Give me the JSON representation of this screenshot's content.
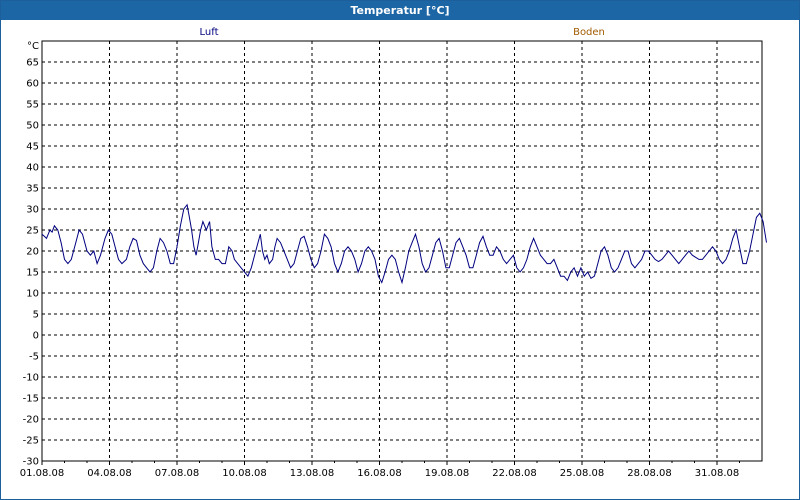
{
  "window": {
    "title": "Temperatur [°C]"
  },
  "colors": {
    "titlebar": "#1d66a5",
    "luft": "#000080",
    "boden": "#a05a00",
    "grid": "#000000"
  },
  "chart_data": {
    "type": "line",
    "title": "Temperatur [°C]",
    "ylabel": "°C",
    "xlabel": "",
    "ylim": [
      -30,
      70
    ],
    "xlim": [
      "01.08.08",
      "02.09.08"
    ],
    "grid": true,
    "legend": [
      "Luft",
      "Boden"
    ],
    "y_ticks": [
      "65",
      "60",
      "55",
      "50",
      "45",
      "40",
      "35",
      "30",
      "25",
      "20",
      "15",
      "10",
      "5",
      "0",
      "-5",
      "-10",
      "-15",
      "-20",
      "-25",
      "-30"
    ],
    "x_ticks": [
      "01.08.08",
      "04.08.08",
      "07.08.08",
      "10.08.08",
      "13.08.08",
      "16.08.08",
      "19.08.08",
      "22.08.08",
      "25.08.08",
      "28.08.08",
      "31.08.08"
    ],
    "series": [
      {
        "name": "Luft",
        "x_unit": "days since 01.08.08",
        "points": [
          [
            0.0,
            24
          ],
          [
            0.1,
            23.5
          ],
          [
            0.2,
            23
          ],
          [
            0.35,
            25
          ],
          [
            0.45,
            24.5
          ],
          [
            0.55,
            26
          ],
          [
            0.7,
            25
          ],
          [
            0.85,
            22
          ],
          [
            1.0,
            18
          ],
          [
            1.15,
            17
          ],
          [
            1.3,
            18
          ],
          [
            1.5,
            22
          ],
          [
            1.65,
            25
          ],
          [
            1.8,
            24
          ],
          [
            2.0,
            20
          ],
          [
            2.15,
            19
          ],
          [
            2.3,
            20
          ],
          [
            2.45,
            17
          ],
          [
            2.6,
            19
          ],
          [
            2.8,
            23
          ],
          [
            2.95,
            25
          ],
          [
            3.1,
            24
          ],
          [
            3.25,
            21
          ],
          [
            3.4,
            18
          ],
          [
            3.55,
            17
          ],
          [
            3.75,
            18
          ],
          [
            3.9,
            21
          ],
          [
            4.05,
            23
          ],
          [
            4.2,
            22.5
          ],
          [
            4.35,
            19
          ],
          [
            4.5,
            17
          ],
          [
            4.65,
            16
          ],
          [
            4.8,
            15
          ],
          [
            4.95,
            16
          ],
          [
            5.1,
            20
          ],
          [
            5.25,
            23
          ],
          [
            5.4,
            22
          ],
          [
            5.55,
            20
          ],
          [
            5.7,
            17
          ],
          [
            5.85,
            17
          ],
          [
            6.0,
            21
          ],
          [
            6.15,
            26
          ],
          [
            6.3,
            30
          ],
          [
            6.45,
            31
          ],
          [
            6.55,
            28
          ],
          [
            6.65,
            25
          ],
          [
            6.75,
            21
          ],
          [
            6.85,
            19
          ],
          [
            6.95,
            22
          ],
          [
            7.05,
            25
          ],
          [
            7.15,
            27
          ],
          [
            7.3,
            25
          ],
          [
            7.45,
            27
          ],
          [
            7.55,
            21
          ],
          [
            7.7,
            18
          ],
          [
            7.85,
            18
          ],
          [
            8.0,
            17
          ],
          [
            8.15,
            17
          ],
          [
            8.3,
            21
          ],
          [
            8.45,
            20
          ],
          [
            8.55,
            18
          ],
          [
            8.7,
            17
          ],
          [
            8.85,
            16
          ],
          [
            9.0,
            15
          ],
          [
            9.15,
            14
          ],
          [
            9.3,
            16
          ],
          [
            9.45,
            19
          ],
          [
            9.6,
            22
          ],
          [
            9.7,
            24
          ],
          [
            9.8,
            20
          ],
          [
            9.9,
            18
          ],
          [
            10.0,
            19
          ],
          [
            10.1,
            17
          ],
          [
            10.25,
            18
          ],
          [
            10.35,
            21
          ],
          [
            10.45,
            23
          ],
          [
            10.6,
            22
          ],
          [
            10.75,
            20
          ],
          [
            10.9,
            18
          ],
          [
            11.05,
            16
          ],
          [
            11.2,
            17
          ],
          [
            11.35,
            20
          ],
          [
            11.5,
            23
          ],
          [
            11.65,
            23.5
          ],
          [
            11.8,
            21
          ],
          [
            11.95,
            18
          ],
          [
            12.1,
            16
          ],
          [
            12.25,
            17
          ],
          [
            12.4,
            20
          ],
          [
            12.55,
            24
          ],
          [
            12.7,
            23
          ],
          [
            12.85,
            21
          ],
          [
            13.0,
            17
          ],
          [
            13.15,
            15
          ],
          [
            13.3,
            17
          ],
          [
            13.45,
            20
          ],
          [
            13.6,
            21
          ],
          [
            13.75,
            20
          ],
          [
            13.9,
            18
          ],
          [
            14.05,
            15
          ],
          [
            14.2,
            17
          ],
          [
            14.35,
            20
          ],
          [
            14.5,
            21
          ],
          [
            14.65,
            20
          ],
          [
            14.8,
            18
          ],
          [
            14.95,
            14
          ],
          [
            15.1,
            12.5
          ],
          [
            15.25,
            15
          ],
          [
            15.4,
            18
          ],
          [
            15.55,
            19
          ],
          [
            15.7,
            18
          ],
          [
            15.85,
            15
          ],
          [
            16.0,
            12.5
          ],
          [
            16.15,
            16
          ],
          [
            16.3,
            20
          ],
          [
            16.45,
            22
          ],
          [
            16.6,
            24
          ],
          [
            16.75,
            21
          ],
          [
            16.9,
            17
          ],
          [
            17.05,
            15
          ],
          [
            17.2,
            16
          ],
          [
            17.35,
            19
          ],
          [
            17.5,
            22
          ],
          [
            17.65,
            23
          ],
          [
            17.8,
            20
          ],
          [
            17.95,
            16
          ],
          [
            18.1,
            16
          ],
          [
            18.25,
            19
          ],
          [
            18.4,
            22
          ],
          [
            18.55,
            23
          ],
          [
            18.7,
            21
          ],
          [
            18.85,
            19
          ],
          [
            19.0,
            16
          ],
          [
            19.15,
            16
          ],
          [
            19.3,
            19
          ],
          [
            19.45,
            22
          ],
          [
            19.6,
            23.5
          ],
          [
            19.75,
            21
          ],
          [
            19.9,
            19
          ],
          [
            20.05,
            19
          ],
          [
            20.2,
            21
          ],
          [
            20.35,
            20
          ],
          [
            20.5,
            18
          ],
          [
            20.65,
            17
          ],
          [
            20.8,
            18
          ],
          [
            20.95,
            19
          ],
          [
            21.1,
            16
          ],
          [
            21.25,
            15
          ],
          [
            21.4,
            16
          ],
          [
            21.55,
            18
          ],
          [
            21.7,
            21
          ],
          [
            21.85,
            23
          ],
          [
            22.0,
            21
          ],
          [
            22.15,
            19
          ],
          [
            22.3,
            18
          ],
          [
            22.45,
            17
          ],
          [
            22.6,
            17
          ],
          [
            22.75,
            18
          ],
          [
            22.9,
            16
          ],
          [
            23.05,
            14
          ],
          [
            23.2,
            14
          ],
          [
            23.35,
            13
          ],
          [
            23.5,
            15
          ],
          [
            23.65,
            16
          ],
          [
            23.8,
            14
          ],
          [
            23.95,
            16
          ],
          [
            24.1,
            14
          ],
          [
            24.25,
            15
          ],
          [
            24.4,
            13.5
          ],
          [
            24.55,
            14
          ],
          [
            24.7,
            17
          ],
          [
            24.85,
            20
          ],
          [
            25.0,
            21
          ],
          [
            25.15,
            19
          ],
          [
            25.3,
            16
          ],
          [
            25.45,
            15
          ],
          [
            25.6,
            16
          ],
          [
            25.75,
            18
          ],
          [
            25.9,
            20
          ],
          [
            26.05,
            20
          ],
          [
            26.2,
            17
          ],
          [
            26.35,
            16
          ],
          [
            26.5,
            17
          ],
          [
            26.65,
            18
          ],
          [
            26.8,
            20
          ],
          [
            26.95,
            20
          ],
          [
            27.1,
            19
          ],
          [
            27.25,
            18
          ],
          [
            27.4,
            17.5
          ],
          [
            27.55,
            18
          ],
          [
            27.7,
            19
          ],
          [
            27.85,
            20
          ],
          [
            28.0,
            19
          ],
          [
            28.15,
            18
          ],
          [
            28.3,
            17
          ],
          [
            28.45,
            18
          ],
          [
            28.6,
            19
          ],
          [
            28.75,
            20
          ],
          [
            28.9,
            19
          ],
          [
            29.05,
            18.5
          ],
          [
            29.2,
            18
          ],
          [
            29.35,
            18
          ],
          [
            29.5,
            19
          ],
          [
            29.65,
            20
          ],
          [
            29.8,
            21
          ],
          [
            29.95,
            20
          ],
          [
            30.1,
            18
          ],
          [
            30.25,
            17
          ],
          [
            30.4,
            18
          ],
          [
            30.55,
            20
          ],
          [
            30.7,
            23
          ],
          [
            30.85,
            25
          ],
          [
            31.0,
            21
          ],
          [
            31.15,
            17
          ],
          [
            31.3,
            17
          ],
          [
            31.45,
            20
          ],
          [
            31.6,
            24
          ],
          [
            31.75,
            28
          ],
          [
            31.9,
            29
          ],
          [
            32.05,
            27
          ],
          [
            32.2,
            22
          ]
        ]
      },
      {
        "name": "Boden",
        "points": []
      }
    ]
  }
}
